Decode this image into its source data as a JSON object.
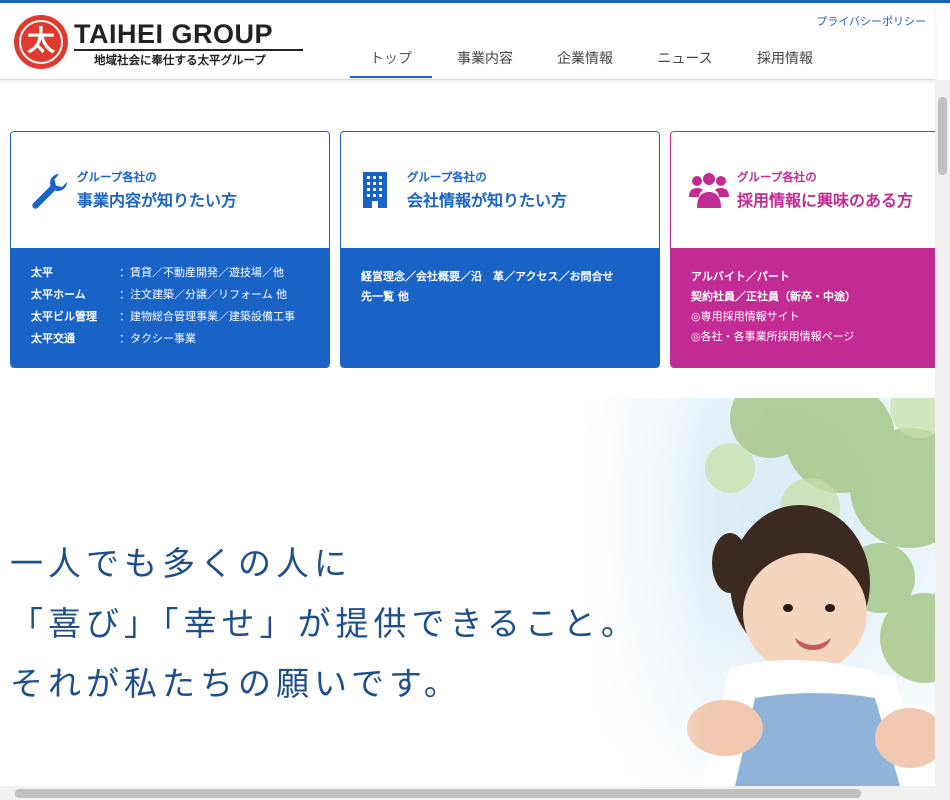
{
  "header": {
    "logo_glyph": "太",
    "logo_name": "TAIHEI GROUP",
    "tagline": "地域社会に奉仕する太平グループ",
    "privacy_link": "プライバシーポリシー",
    "nav": [
      {
        "label": "トップ",
        "active": true
      },
      {
        "label": "事業内容",
        "active": false
      },
      {
        "label": "企業情報",
        "active": false
      },
      {
        "label": "ニュース",
        "active": false
      },
      {
        "label": "採用情報",
        "active": false
      }
    ]
  },
  "cards": {
    "business": {
      "icon": "wrench-icon",
      "subtitle": "グループ各社の",
      "title": "事業内容が知りたい方",
      "rows": [
        {
          "name": "太平",
          "desc": "：賃貸／不動産開発／遊技場／他"
        },
        {
          "name": "太平ホーム",
          "desc": "：注文建築／分譲／リフォーム 他"
        },
        {
          "name": "太平ビル管理",
          "desc": "：建物総合管理事業／建築設備工事"
        },
        {
          "name": "太平交通",
          "desc": "：タクシー事業"
        }
      ]
    },
    "company": {
      "icon": "building-icon",
      "subtitle": "グループ各社の",
      "title": "会社情報が知りたい方",
      "line1": "経営理念／会社概要／沿　革／アクセス／お問合せ",
      "line2": "先一覧 他"
    },
    "recruit": {
      "icon": "people-group-icon",
      "subtitle": "グループ各社の",
      "title": "採用情報に興味のある方",
      "line1": "アルバイト／パート",
      "line2": "契約社員／正社員（新卒・中途）",
      "line3": "◎専用採用情報サイト",
      "line4": "◎各社・各事業所採用情報ページ"
    }
  },
  "hero": {
    "line1": "一人でも多くの人に",
    "line2": "「喜び」「幸せ」が提供できること。",
    "line3": "それが私たちの願いです。"
  },
  "colors": {
    "accent_blue": "#1a63c6",
    "accent_pink": "#c22b94",
    "logo_red": "#e03a2f",
    "hero_text": "#1f4f8a"
  }
}
